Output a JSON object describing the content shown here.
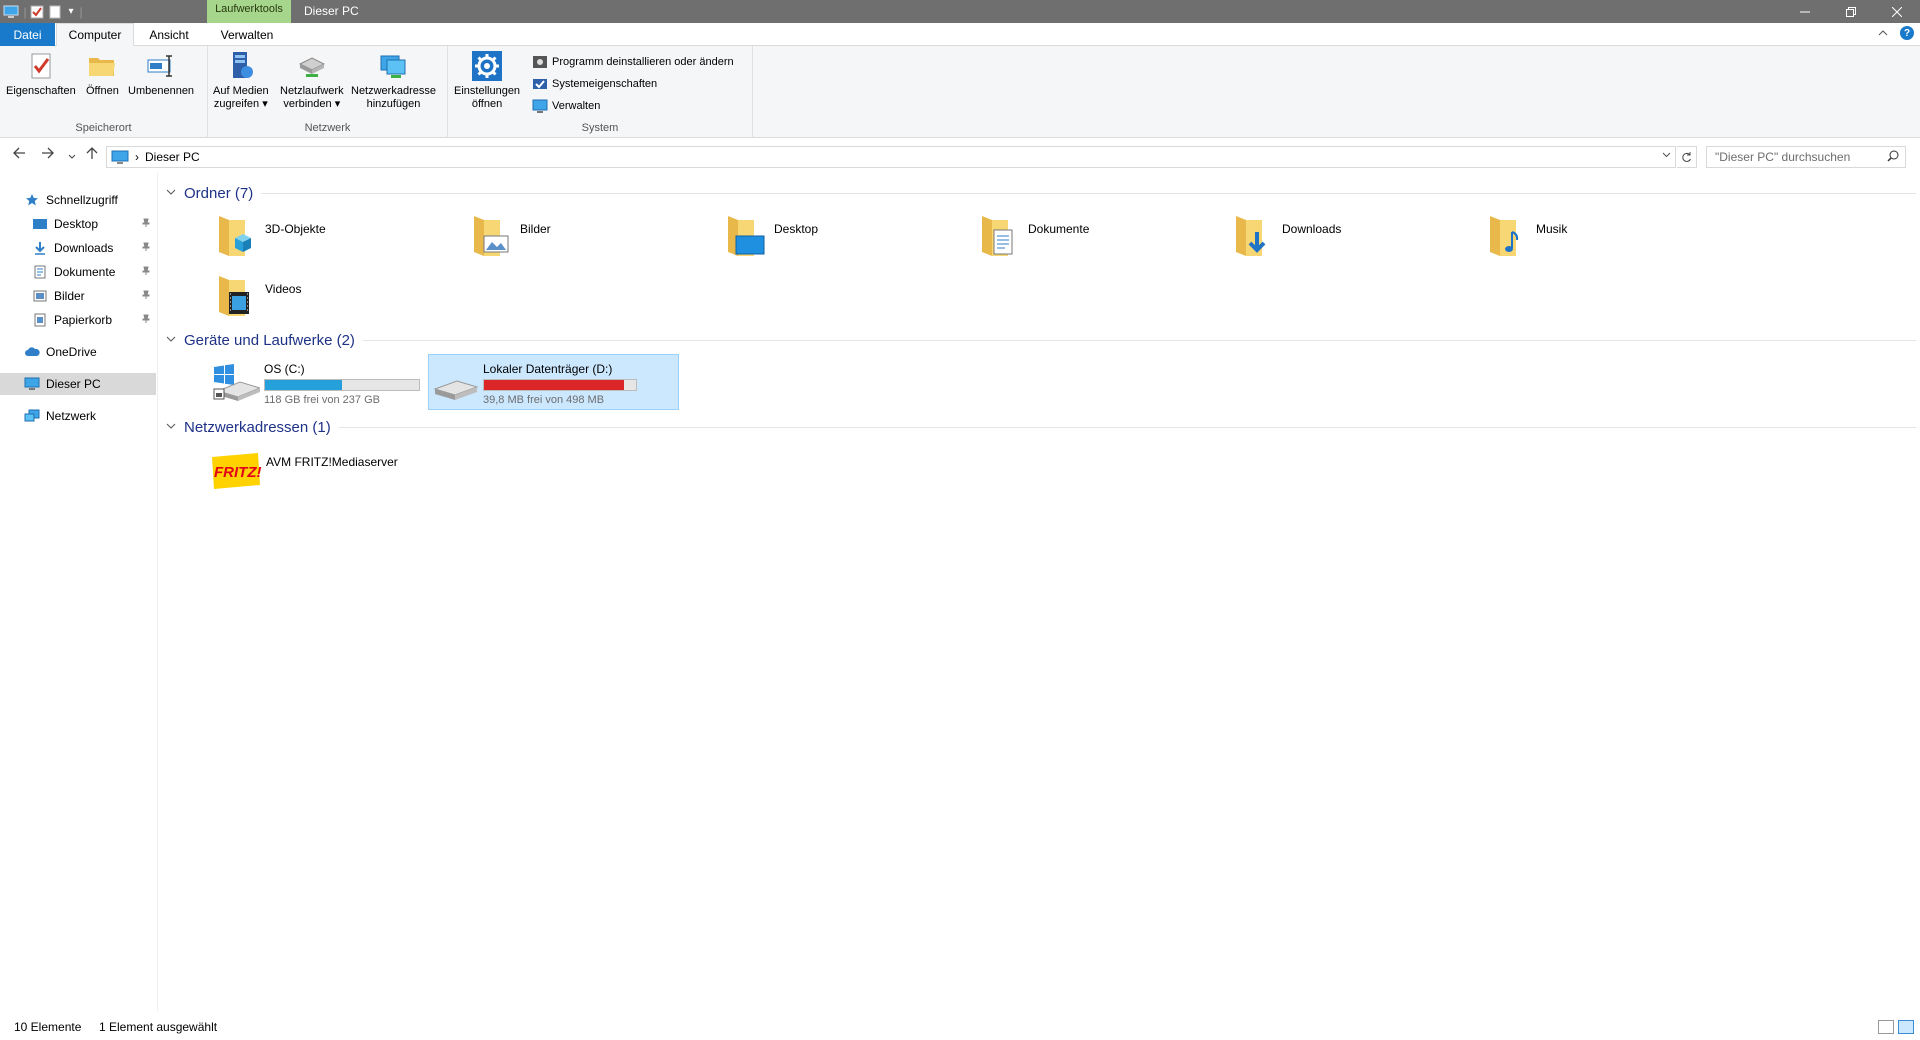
{
  "window": {
    "title": "Dieser PC",
    "context_tab": "Laufwerktools",
    "qat_dropdown": "▾"
  },
  "tabs": {
    "file": "Datei",
    "computer": "Computer",
    "view": "Ansicht",
    "manage": "Verwalten",
    "help": "?"
  },
  "ribbon": {
    "groups": {
      "location": {
        "label": "Speicherort",
        "properties": "Eigenschaften",
        "open": "Öffnen",
        "rename": "Umbenennen"
      },
      "network": {
        "label": "Netzwerk",
        "media_line1": "Auf Medien",
        "media_line2": "zugreifen",
        "netdrive_line1": "Netzlaufwerk",
        "netdrive_line2": "verbinden",
        "netaddr_line1": "Netzwerkadresse",
        "netaddr_line2": "hinzufügen"
      },
      "system": {
        "label": "System",
        "settings_line1": "Einstellungen",
        "settings_line2": "öffnen",
        "uninstall": "Programm deinstallieren oder ändern",
        "sysprops": "Systemeigenschaften",
        "manage": "Verwalten"
      }
    }
  },
  "address": {
    "crumb": "Dieser PC",
    "separator": "›",
    "search_placeholder": "\"Dieser PC\" durchsuchen"
  },
  "navpane": {
    "quick_access": "Schnellzugriff",
    "items": [
      {
        "label": "Desktop",
        "icon": "desktop-icon"
      },
      {
        "label": "Downloads",
        "icon": "download-icon"
      },
      {
        "label": "Dokumente",
        "icon": "document-icon"
      },
      {
        "label": "Bilder",
        "icon": "pictures-icon"
      },
      {
        "label": "Papierkorb",
        "icon": "recycle-bin-icon"
      }
    ],
    "onedrive": "OneDrive",
    "this_pc": "Dieser PC",
    "network": "Netzwerk"
  },
  "sections": {
    "folders": "Ordner (7)",
    "devices": "Geräte und Laufwerke (2)",
    "netlocs": "Netzwerkadressen (1)"
  },
  "folders": [
    {
      "name": "3D-Objekte",
      "icon": "3d-objects-folder-icon"
    },
    {
      "name": "Bilder",
      "icon": "pictures-folder-icon"
    },
    {
      "name": "Desktop",
      "icon": "desktop-folder-icon"
    },
    {
      "name": "Dokumente",
      "icon": "documents-folder-icon"
    },
    {
      "name": "Downloads",
      "icon": "downloads-folder-icon"
    },
    {
      "name": "Musik",
      "icon": "music-folder-icon"
    },
    {
      "name": "Videos",
      "icon": "videos-folder-icon"
    }
  ],
  "drives": [
    {
      "name": "OS (C:)",
      "free": "118 GB frei von 237 GB",
      "used_fraction": 0.5,
      "color": "#26a0da"
    },
    {
      "name": "Lokaler Datenträger (D:)",
      "free": "39,8 MB frei von 498 MB",
      "used_fraction": 0.92,
      "color": "#da2626"
    }
  ],
  "netlocs": [
    {
      "name": "AVM FRITZ!Mediaserver",
      "logo_text": "FRITZ!"
    }
  ],
  "status": {
    "count": "10 Elemente",
    "selected": "1 Element ausgewählt"
  }
}
